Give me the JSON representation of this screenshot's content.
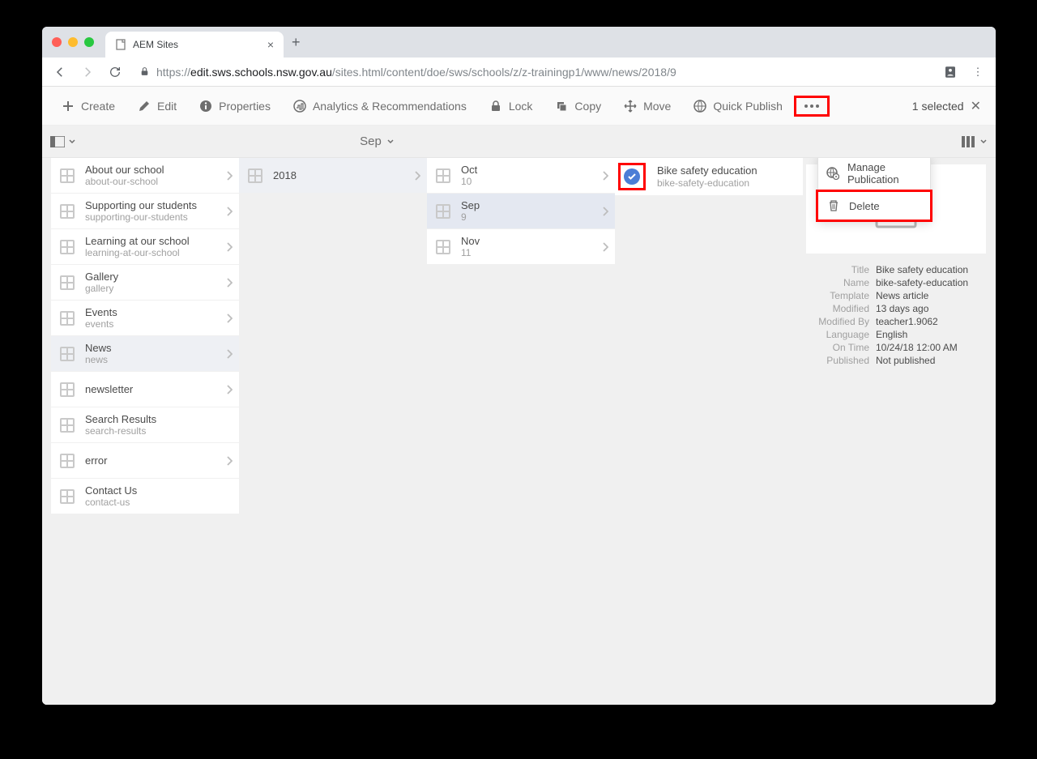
{
  "tab_title": "AEM Sites",
  "url_host": "edit.sws.schools.nsw.gov.au",
  "url_path": "/sites.html/content/doe/sws/schools/z/z-trainingp1/www/news/2018/9",
  "url_prefix": "https://",
  "actions": {
    "create": "Create",
    "edit": "Edit",
    "properties": "Properties",
    "analytics": "Analytics & Recommendations",
    "lock": "Lock",
    "copy": "Copy",
    "move": "Move",
    "quick_publish": "Quick Publish"
  },
  "selected_text": "1 selected",
  "breadcrumb": "Sep",
  "dropdown": {
    "manage_publication": "Manage Publication",
    "delete": "Delete"
  },
  "col1": [
    {
      "title": "About our school",
      "sub": "about-our-school",
      "chev": true
    },
    {
      "title": "Supporting our students",
      "sub": "supporting-our-students",
      "chev": true
    },
    {
      "title": "Learning at our school",
      "sub": "learning-at-our-school",
      "chev": true
    },
    {
      "title": "Gallery",
      "sub": "gallery",
      "chev": true
    },
    {
      "title": "Events",
      "sub": "events",
      "chev": true
    },
    {
      "title": "News",
      "sub": "news",
      "chev": true,
      "sel": true
    },
    {
      "title": "newsletter",
      "sub": "",
      "chev": true
    },
    {
      "title": "Search Results",
      "sub": "search-results",
      "chev": false
    },
    {
      "title": "error",
      "sub": "",
      "chev": true
    },
    {
      "title": "Contact Us",
      "sub": "contact-us",
      "chev": false
    }
  ],
  "col2": [
    {
      "title": "2018",
      "sub": "",
      "chev": true,
      "sel": true
    }
  ],
  "col3": [
    {
      "title": "Oct",
      "sub": "10",
      "chev": true
    },
    {
      "title": "Sep",
      "sub": "9",
      "chev": true,
      "sel": true
    },
    {
      "title": "Nov",
      "sub": "11",
      "chev": true
    }
  ],
  "col4": [
    {
      "title": "Bike safety education",
      "sub": "bike-safety-education",
      "check": true
    }
  ],
  "detail": {
    "Title": "Bike safety education",
    "Name": "bike-safety-education",
    "Template": "News article",
    "Modified": "13 days ago",
    "Modified By": "teacher1.9062",
    "Language": "English",
    "On Time": "10/24/18 12:00 AM",
    "Published": "Not published"
  },
  "detail_order": [
    "Title",
    "Name",
    "Template",
    "Modified",
    "Modified By",
    "Language",
    "On Time",
    "Published"
  ]
}
